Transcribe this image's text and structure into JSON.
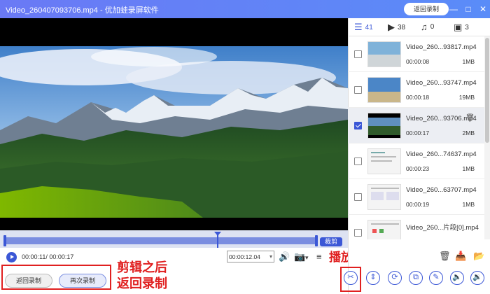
{
  "window": {
    "title": "Video_260407093706.mp4 - 优加蛙录屏软件",
    "back_button": "返回录制",
    "minimize": "—",
    "maximize": "□",
    "close": "✕"
  },
  "player": {
    "current_time": "00:00:11",
    "total_time": "/ 00:00:17",
    "time_field": "00:00:12.04",
    "cut_label": "裁剪",
    "playhead_position": 0.68
  },
  "bottom_buttons": {
    "back": "返回录制",
    "record_again": "再次录制"
  },
  "annotations": {
    "left": "剪辑之后\n返回录制",
    "right": "播放后剪辑视频"
  },
  "tabs": [
    {
      "icon": "list-icon",
      "count": "41"
    },
    {
      "icon": "video-icon",
      "count": "38"
    },
    {
      "icon": "music-icon",
      "count": "0"
    },
    {
      "icon": "image-icon",
      "count": "3"
    }
  ],
  "files": [
    {
      "name": "Video_260...93817.mp4",
      "duration": "00:00:08",
      "size": "1MB",
      "checked": false
    },
    {
      "name": "Video_260...93747.mp4",
      "duration": "00:00:18",
      "size": "19MB",
      "checked": false
    },
    {
      "name": "Video_260...93706.mp4",
      "duration": "00:00:17",
      "size": "2MB",
      "checked": true
    },
    {
      "name": "Video_260...74637.mp4",
      "duration": "00:00:23",
      "size": "1MB",
      "checked": false
    },
    {
      "name": "Video_260...63707.mp4",
      "duration": "00:00:19",
      "size": "1MB",
      "checked": false
    },
    {
      "name": "Video_260...片段[0].mp4",
      "duration": "",
      "size": "",
      "checked": false
    }
  ]
}
